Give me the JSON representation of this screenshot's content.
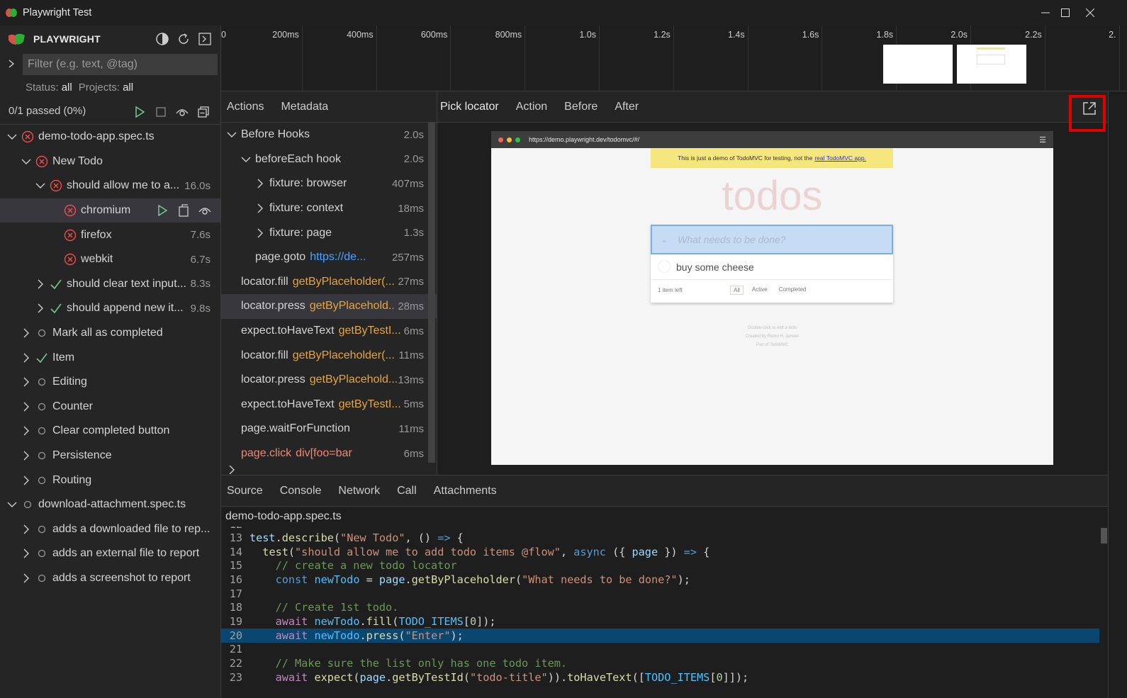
{
  "window": {
    "title": "Playwright Test",
    "controls": [
      "minimize-icon",
      "maximize-icon",
      "close-icon"
    ]
  },
  "sidebar": {
    "brand": "PLAYWRIGHT",
    "filter_placeholder": "Filter (e.g. text, @tag)",
    "status_label": "Status:",
    "status_value": "all",
    "projects_label": "Projects:",
    "projects_value": "all",
    "passed_summary": "0/1 passed (0%)",
    "tree": [
      {
        "label": "demo-todo-app.spec.ts",
        "status": "failed",
        "indent": 0,
        "expanded": true,
        "duration": ""
      },
      {
        "label": "New Todo",
        "status": "failed",
        "indent": 1,
        "expanded": true,
        "duration": ""
      },
      {
        "label": "should allow me to a...",
        "status": "failed",
        "indent": 2,
        "expanded": true,
        "duration": "16.0s"
      },
      {
        "label": "chromium",
        "status": "failed",
        "indent": 3,
        "leaf": true,
        "selected": true,
        "duration": ""
      },
      {
        "label": "firefox",
        "status": "failed",
        "indent": 3,
        "leaf": true,
        "duration": "7.6s"
      },
      {
        "label": "webkit",
        "status": "failed",
        "indent": 3,
        "leaf": true,
        "duration": "6.7s"
      },
      {
        "label": "should clear text input...",
        "status": "passed",
        "indent": 2,
        "expanded": false,
        "duration": "8.3s"
      },
      {
        "label": "should append new it...",
        "status": "passed",
        "indent": 2,
        "expanded": false,
        "duration": "9.8s"
      },
      {
        "label": "Mark all as completed",
        "status": "none",
        "indent": 1,
        "expanded": false,
        "duration": ""
      },
      {
        "label": "Item",
        "status": "passed",
        "indent": 1,
        "expanded": false,
        "duration": ""
      },
      {
        "label": "Editing",
        "status": "none",
        "indent": 1,
        "expanded": false,
        "duration": ""
      },
      {
        "label": "Counter",
        "status": "none",
        "indent": 1,
        "expanded": false,
        "duration": ""
      },
      {
        "label": "Clear completed button",
        "status": "none",
        "indent": 1,
        "expanded": false,
        "duration": ""
      },
      {
        "label": "Persistence",
        "status": "none",
        "indent": 1,
        "expanded": false,
        "duration": ""
      },
      {
        "label": "Routing",
        "status": "none",
        "indent": 1,
        "expanded": false,
        "duration": ""
      },
      {
        "label": "download-attachment.spec.ts",
        "status": "none",
        "indent": 0,
        "expanded": true,
        "duration": ""
      },
      {
        "label": "adds a downloaded file to rep...",
        "status": "none",
        "indent": 1,
        "expanded": false,
        "duration": ""
      },
      {
        "label": "adds an external file to report",
        "status": "none",
        "indent": 1,
        "expanded": false,
        "duration": ""
      },
      {
        "label": "adds a screenshot to report",
        "status": "none",
        "indent": 1,
        "expanded": false,
        "duration": ""
      }
    ]
  },
  "timeline": {
    "ticks": [
      "0",
      "200ms",
      "400ms",
      "600ms",
      "800ms",
      "1.0s",
      "1.2s",
      "1.4s",
      "1.6s",
      "1.8s",
      "2.0s",
      "2.2s",
      "2."
    ]
  },
  "actions_panel": {
    "tabs": [
      "Actions",
      "Metadata"
    ],
    "rows": [
      {
        "name": "Before Hooks",
        "arg": "",
        "duration": "2.0s",
        "indent": 0,
        "twisty": "open"
      },
      {
        "name": "beforeEach hook",
        "arg": "",
        "duration": "2.0s",
        "indent": 1,
        "twisty": "open"
      },
      {
        "name": "fixture: browser",
        "arg": "",
        "duration": "407ms",
        "indent": 2,
        "twisty": "closed"
      },
      {
        "name": "fixture: context",
        "arg": "",
        "duration": "18ms",
        "indent": 2,
        "twisty": "closed"
      },
      {
        "name": "fixture: page",
        "arg": "",
        "duration": "1.3s",
        "indent": 2,
        "twisty": "closed"
      },
      {
        "name": "page.goto",
        "arg": "https://de...",
        "arg_kind": "link",
        "duration": "257ms",
        "indent": 2,
        "twisty": "none"
      },
      {
        "name": "locator.fill",
        "arg": "getByPlaceholder(...",
        "arg_kind": "selector",
        "duration": "27ms",
        "indent": 1,
        "twisty": "none"
      },
      {
        "name": "locator.press",
        "arg": "getByPlacehold...",
        "arg_kind": "selector",
        "duration": "28ms",
        "indent": 1,
        "twisty": "none",
        "selected": true
      },
      {
        "name": "expect.toHaveText",
        "arg": "getByTestI...",
        "arg_kind": "selector",
        "duration": "6ms",
        "indent": 1,
        "twisty": "none"
      },
      {
        "name": "locator.fill",
        "arg": "getByPlaceholder(...",
        "arg_kind": "selector",
        "duration": "11ms",
        "indent": 1,
        "twisty": "none"
      },
      {
        "name": "locator.press",
        "arg": "getByPlacehold...",
        "arg_kind": "selector",
        "duration": "13ms",
        "indent": 1,
        "twisty": "none"
      },
      {
        "name": "expect.toHaveText",
        "arg": "getByTestI...",
        "arg_kind": "selector",
        "duration": "5ms",
        "indent": 1,
        "twisty": "none"
      },
      {
        "name": "page.waitForFunction",
        "arg": "",
        "duration": "11ms",
        "indent": 1,
        "twisty": "none"
      },
      {
        "name": "page.click",
        "arg": "div[foo=bar",
        "arg_kind": "error",
        "duration": "6ms",
        "indent": 1,
        "twisty": "none",
        "error": true
      }
    ]
  },
  "snapshot_panel": {
    "tabs": [
      "Pick locator",
      "Action",
      "Before",
      "After"
    ],
    "browser_url": "https://demo.playwright.dev/todomvc/#/",
    "banner_text": "This is just a demo of TodoMVC for testing, not the",
    "banner_link": "real TodoMVC app.",
    "heading": "todos",
    "input_placeholder": "What needs to be done?",
    "todo_item": "buy some cheese",
    "items_left": "1 item left",
    "filters": [
      "All",
      "Active",
      "Completed"
    ],
    "info_lines": [
      "Double-click to edit a todo",
      "Created by Remo H. Jansen",
      "Part of TodoMVC"
    ]
  },
  "bottom_panel": {
    "tabs": [
      "Source",
      "Console",
      "Network",
      "Call",
      "Attachments"
    ],
    "file_name": "demo-todo-app.spec.ts",
    "highlight_line": "20"
  },
  "colors": {
    "accent_highlight": "#e00000",
    "failed": "#f14c4c",
    "passed": "#73c991",
    "selector": "#e8a53a"
  }
}
